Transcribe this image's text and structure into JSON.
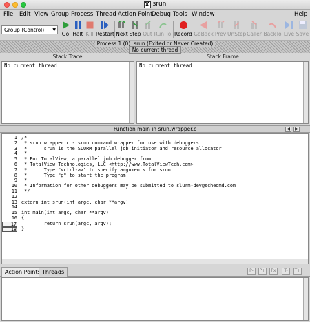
{
  "window": {
    "title": "srun"
  },
  "menu": [
    "File",
    "Edit",
    "View",
    "Group",
    "Process",
    "Thread",
    "Action Point",
    "Debug",
    "Tools",
    "Window",
    "Help"
  ],
  "toolbar": {
    "group_select": "Group (Control)",
    "buttons": [
      "Go",
      "Halt",
      "Kill",
      "Restart",
      "Next",
      "Step",
      "Out",
      "Run To",
      "Record",
      "GoBack",
      "Prev",
      "UnStep",
      "Caller",
      "BackTo",
      "Live",
      "Save"
    ]
  },
  "status": {
    "process": "Process 1 (0): srun (Exited or Never Created)",
    "thread": "No current thread"
  },
  "stack_trace": {
    "header": "Stack Trace",
    "content": "No current thread"
  },
  "stack_frame": {
    "header": "Stack Frame",
    "content": "No current thread"
  },
  "source": {
    "header": "Function main in srun.wrapper.c",
    "line_numbers": [
      "1",
      "2",
      "3",
      "4",
      "5",
      "6",
      "7",
      "8",
      "9",
      "10",
      "11",
      "12",
      "13",
      "14",
      "15",
      "16",
      "17",
      "18"
    ],
    "lines": [
      "/*",
      " * srun wrapper.c - srun command wrapper for use with debuggers",
      " *      srun is the SLURM parallel job initiator and resource allocator",
      " *",
      " * For TotalView, a parallel job debugger from",
      " * TotalView Technologies, LLC <http://www.TotalViewTech.com>",
      " *      Type \"<ctrl-a>\" to specify arguments for srun",
      " *      Type \"g\" to start the program",
      " *",
      " * Information for other debuggers may be submitted to slurm-dev@schedmd.com",
      " */",
      "",
      "extern int srun(int argc, char **argv);",
      "",
      "int main(int argc, char **argv)",
      "{",
      "        return srun(argc, argv);",
      "}"
    ]
  },
  "bottom_tabs": [
    "Action Points",
    "Threads"
  ],
  "bottom_buttons": [
    "P-",
    "P+",
    "Px",
    "T-",
    "T+"
  ],
  "colors": {
    "go": "#2e9e3a",
    "halt": "#2a5fbf",
    "kill": "#e07a6e",
    "record": "#e02020"
  }
}
